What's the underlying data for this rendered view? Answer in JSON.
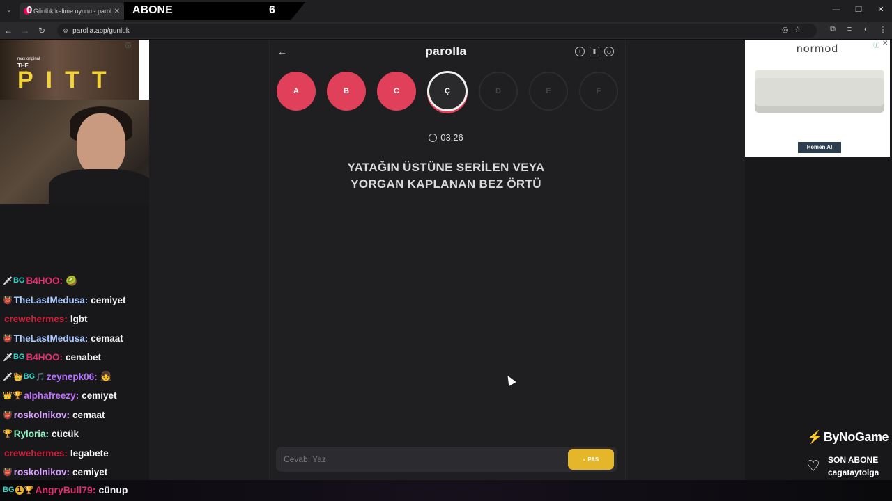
{
  "browser": {
    "tab_title": "Günlük kelime oyunu - parolla",
    "url": "parolla.app/gunluk"
  },
  "overlay": {
    "counter": "0",
    "abone_label": "ABONE",
    "abone_count": "6"
  },
  "left_ad": {
    "max_text": "max original",
    "the": "THE",
    "pitt": "PITT"
  },
  "chat": [
    {
      "badges": [
        "🗡",
        "BG"
      ],
      "user": "B4HOO",
      "user_color": "#e0306a",
      "msg": "🥝"
    },
    {
      "badges": [
        "👹"
      ],
      "user": "TheLastMedusa",
      "user_color": "#a9c9ff",
      "msg": "cemiyet"
    },
    {
      "badges": [],
      "user": "crewehermes",
      "user_color": "#c9203a",
      "msg": "lgbt"
    },
    {
      "badges": [
        "👹"
      ],
      "user": "TheLastMedusa",
      "user_color": "#a9c9ff",
      "msg": "cemaat"
    },
    {
      "badges": [
        "🗡",
        "BG"
      ],
      "user": "B4HOO",
      "user_color": "#e0306a",
      "msg": "cenabet"
    },
    {
      "badges": [
        "🗡",
        "👑",
        "BG",
        "🎵"
      ],
      "user": "zeynepk06",
      "user_color": "#b574ff",
      "msg": "👧"
    },
    {
      "badges": [
        "👑",
        "🏆"
      ],
      "user": "alphafreezy",
      "user_color": "#c070ff",
      "msg": "cemiyet"
    },
    {
      "badges": [
        "👹"
      ],
      "user": "roskolnikov",
      "user_color": "#d8a0ff",
      "msg": "cemaat"
    },
    {
      "badges": [
        "🏆"
      ],
      "user": "Ryloria",
      "user_color": "#8ff0c0",
      "msg": "cücük"
    },
    {
      "badges": [],
      "user": "crewehermes",
      "user_color": "#c9203a",
      "msg": "legabete"
    },
    {
      "badges": [
        "👹"
      ],
      "user": "roskolnikov",
      "user_color": "#d8a0ff",
      "msg": "cemiyet"
    }
  ],
  "bottom_chat": {
    "badges": [
      "BG",
      "1",
      "🏆"
    ],
    "user": "AngryBull79",
    "user_color": "#e0306a",
    "msg": "cünup"
  },
  "game": {
    "brand": "parolla",
    "letters": [
      {
        "l": "A",
        "state": "done"
      },
      {
        "l": "B",
        "state": "done"
      },
      {
        "l": "C",
        "state": "done"
      },
      {
        "l": "Ç",
        "state": "active"
      },
      {
        "l": "D",
        "state": "pending"
      },
      {
        "l": "E",
        "state": "pending"
      },
      {
        "l": "F",
        "state": "pending"
      }
    ],
    "timer": "03:26",
    "question_line1": "YATAĞIN ÜSTÜNE SERİLEN VEYA",
    "question_line2": "YORGAN KAPLANAN BEZ ÖRTÜ",
    "answer_placeholder": "Cevabı Yaz",
    "pas_label": "PAS"
  },
  "right_ad": {
    "brand": "normod",
    "button": "Hemen Al"
  },
  "right_overlay": {
    "bynogame": "ByNoGame",
    "son_abone_title": "SON ABONE",
    "son_abone_name": "cagataytolga"
  }
}
